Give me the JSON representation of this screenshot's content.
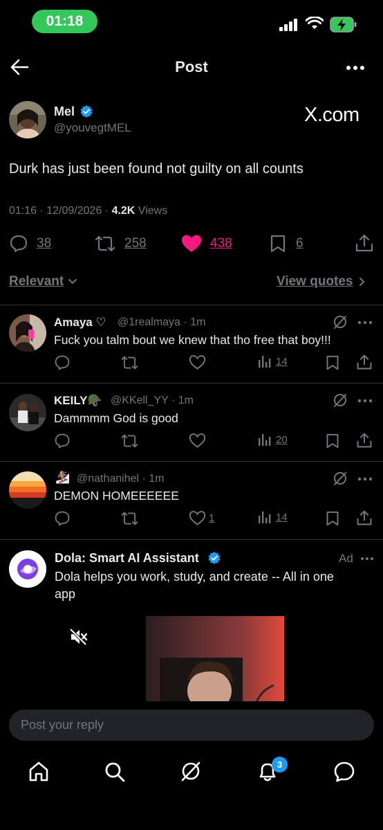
{
  "status_bar": {
    "time": "01:18"
  },
  "header": {
    "title": "Post"
  },
  "post": {
    "author_name": "Mel",
    "author_handle": "@youvegtMEL",
    "watermark": "X.com",
    "text": "Durk has just been found not guilty on all counts",
    "time": "01:16 · 12/09/2026 · ",
    "views_count": "4.2K",
    "views_label": " Views",
    "replies": "38",
    "reposts": "258",
    "likes": "438",
    "bookmarks": "6"
  },
  "filters": {
    "sort_label": "Relevant",
    "quotes_label": "View quotes"
  },
  "replies": [
    {
      "name": "Amaya ♡",
      "handle": "@1realmaya · 1m",
      "text": "Fuck you talm bout we knew that tho free that boy!!!",
      "likes": "",
      "views": "14"
    },
    {
      "name": "KEILY🪖",
      "handle": "@KKell_YY · 1m",
      "text": "Dammmm God is good",
      "likes": "",
      "views": "20"
    },
    {
      "name": "🏂",
      "handle": "@nathanihel · 1m",
      "text": "DEMON HOMEEEEEE",
      "likes": "1",
      "views": "14"
    }
  ],
  "ad": {
    "name": "Dola: Smart AI Assistant",
    "ad_label": "Ad",
    "text_line1": "Dola helps you work, study, and create -- All in one",
    "text_line2": "app"
  },
  "compose": {
    "placeholder": "Post your reply"
  },
  "bottom_nav": {
    "notifications_badge": "3"
  },
  "colors": {
    "like_pink": "#f91880",
    "verified_blue": "#1d9bf0",
    "status_green": "#34c759"
  }
}
